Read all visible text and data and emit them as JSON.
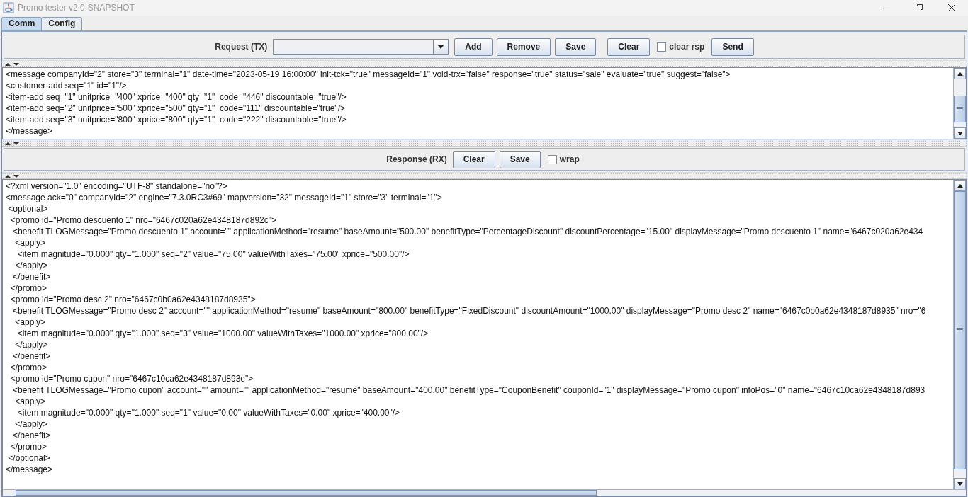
{
  "window": {
    "title": "Promo tester v2.0-SNAPSHOT"
  },
  "tabs": [
    {
      "label": "Comm",
      "selected": true
    },
    {
      "label": "Config",
      "selected": false
    }
  ],
  "request": {
    "label": "Request (TX)",
    "buttons": [
      "Add",
      "Remove",
      "Save",
      "Clear"
    ],
    "clear_rsp": {
      "label": "clear rsp",
      "checked": false
    },
    "send": "Send"
  },
  "request_text": [
    "<message companyId=\"2\" store=\"3\" terminal=\"1\" date-time=\"2023-05-19 16:00:00\" init-tck=\"true\" messageId=\"1\" void-trx=\"false\" response=\"true\" status=\"sale\" evaluate=\"true\" suggest=\"false\">",
    "<customer-add seq=\"1\" id=\"1\"/>",
    "<item-add seq=\"1\" unitprice=\"400\" xprice=\"400\" qty=\"1\"  code=\"446\" discountable=\"true\"/>",
    "<item-add seq=\"2\" unitprice=\"500\" xprice=\"500\" qty=\"1\"  code=\"111\" discountable=\"true\"/>",
    "<item-add seq=\"3\" unitprice=\"800\" xprice=\"800\" qty=\"1\"  code=\"222\" discountable=\"true\"/>",
    "</message>"
  ],
  "response": {
    "label": "Response (RX)",
    "buttons": [
      "Clear",
      "Save"
    ],
    "wrap": {
      "label": "wrap",
      "checked": false
    }
  },
  "response_text": [
    "<?xml version=\"1.0\" encoding=\"UTF-8\" standalone=\"no\"?>",
    "<message ack=\"0\" companyId=\"2\" engine=\"7.3.0RC3#69\" mapversion=\"32\" messageId=\"1\" store=\"3\" terminal=\"1\">",
    " <optional>",
    "  <promo id=\"Promo descuento 1\" nro=\"6467c020a62e4348187d892c\">",
    "   <benefit TLOGMessage=\"Promo descuento 1\" account=\"\" applicationMethod=\"resume\" baseAmount=\"500.00\" benefitType=\"PercentageDiscount\" discountPercentage=\"15.00\" displayMessage=\"Promo descuento 1\" name=\"6467c020a62e434",
    "    <apply>",
    "     <item magnitude=\"0.000\" qty=\"1.000\" seq=\"2\" value=\"75.00\" valueWithTaxes=\"75.00\" xprice=\"500.00\"/>",
    "    </apply>",
    "   </benefit>",
    "  </promo>",
    "  <promo id=\"Promo desc 2\" nro=\"6467c0b0a62e4348187d8935\">",
    "   <benefit TLOGMessage=\"Promo desc 2\" account=\"\" applicationMethod=\"resume\" baseAmount=\"800.00\" benefitType=\"FixedDiscount\" discountAmount=\"1000.00\" displayMessage=\"Promo desc 2\" name=\"6467c0b0a62e4348187d8935\" nro=\"6",
    "    <apply>",
    "     <item magnitude=\"0.000\" qty=\"1.000\" seq=\"3\" value=\"1000.00\" valueWithTaxes=\"1000.00\" xprice=\"800.00\"/>",
    "    </apply>",
    "   </benefit>",
    "  </promo>",
    "  <promo id=\"Promo cupon\" nro=\"6467c10ca62e4348187d893e\">",
    "   <benefit TLOGMessage=\"Promo cupon\" account=\"\" amount=\"\" applicationMethod=\"resume\" baseAmount=\"400.00\" benefitType=\"CouponBenefit\" couponId=\"1\" displayMessage=\"Promo cupon\" infoPos=\"0\" name=\"6467c10ca62e4348187d893",
    "    <apply>",
    "     <item magnitude=\"0.000\" qty=\"1.000\" seq=\"1\" value=\"0.00\" valueWithTaxes=\"0.00\" xprice=\"400.00\"/>",
    "    </apply>",
    "   </benefit>",
    "  </promo>",
    " </optional>",
    "</message>"
  ]
}
